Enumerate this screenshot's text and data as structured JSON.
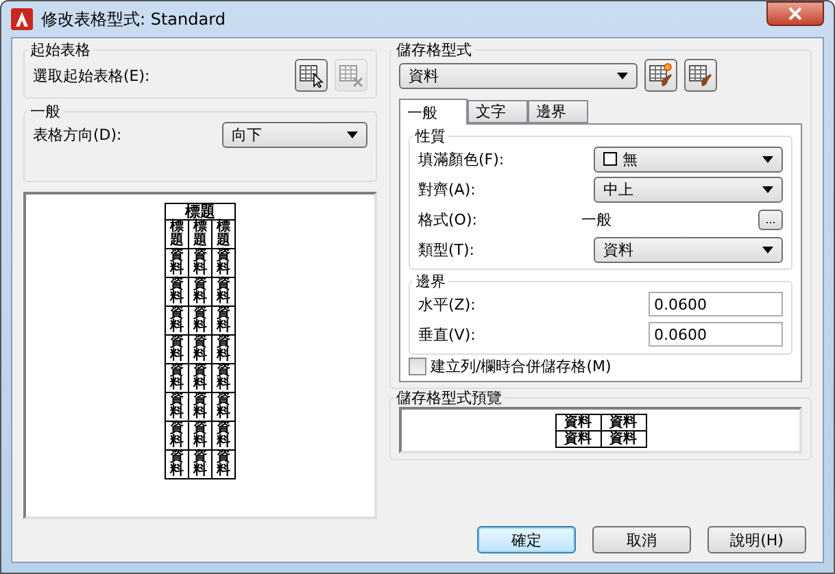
{
  "window": {
    "title": "修改表格型式: Standard"
  },
  "starting_table": {
    "title": "起始表格",
    "label": "選取起始表格(E):",
    "buttons": [
      {
        "kind": "select",
        "disabled": false
      },
      {
        "kind": "remove",
        "disabled": true
      }
    ]
  },
  "general": {
    "title": "一般",
    "label": "表格方向(D):",
    "value": "向下"
  },
  "table_preview": {
    "title": "標題",
    "header_row": [
      "標題",
      "標題",
      "標題"
    ],
    "rows": [
      [
        "資料",
        "資料",
        "資料"
      ],
      [
        "資料",
        "資料",
        "資料"
      ],
      [
        "資料",
        "資料",
        "資料"
      ],
      [
        "資料",
        "資料",
        "資料"
      ],
      [
        "資料",
        "資料",
        "資料"
      ],
      [
        "資料",
        "資料",
        "資料"
      ],
      [
        "資料",
        "資料",
        "資料"
      ],
      [
        "資料",
        "資料",
        "資料"
      ]
    ]
  },
  "cell_styles": {
    "title": "儲存格型式",
    "value": "資料"
  },
  "tabs": [
    {
      "label": "一般",
      "selected": true
    },
    {
      "label": "文字",
      "selected": false
    },
    {
      "label": "邊界",
      "selected": false
    }
  ],
  "properties": {
    "title": "性質",
    "fields": [
      {
        "kind": "color-dropdown",
        "label": "填滿顏色(F):",
        "value": "無"
      },
      {
        "kind": "dropdown",
        "label": "對齊(A):",
        "value": "中上"
      },
      {
        "kind": "browse",
        "label": "格式(O):",
        "value": "一般",
        "button": "..."
      },
      {
        "kind": "dropdown",
        "label": "類型(T):",
        "value": "資料"
      }
    ]
  },
  "margins": {
    "title": "邊界",
    "fields": [
      {
        "label": "水平(Z):",
        "value": "0.0600"
      },
      {
        "label": "垂直(V):",
        "value": "0.0600"
      }
    ]
  },
  "merge_checkbox": {
    "label": "建立列/欄時合併儲存格(M)",
    "checked": false
  },
  "cell_style_preview": {
    "title": "儲存格型式預覽",
    "rows": [
      [
        "資料",
        "資料"
      ],
      [
        "資料",
        "資料"
      ]
    ]
  },
  "buttons": [
    {
      "label": "確定",
      "default": true
    },
    {
      "label": "取消",
      "default": false
    },
    {
      "label": "說明(H)",
      "default": false
    }
  ]
}
